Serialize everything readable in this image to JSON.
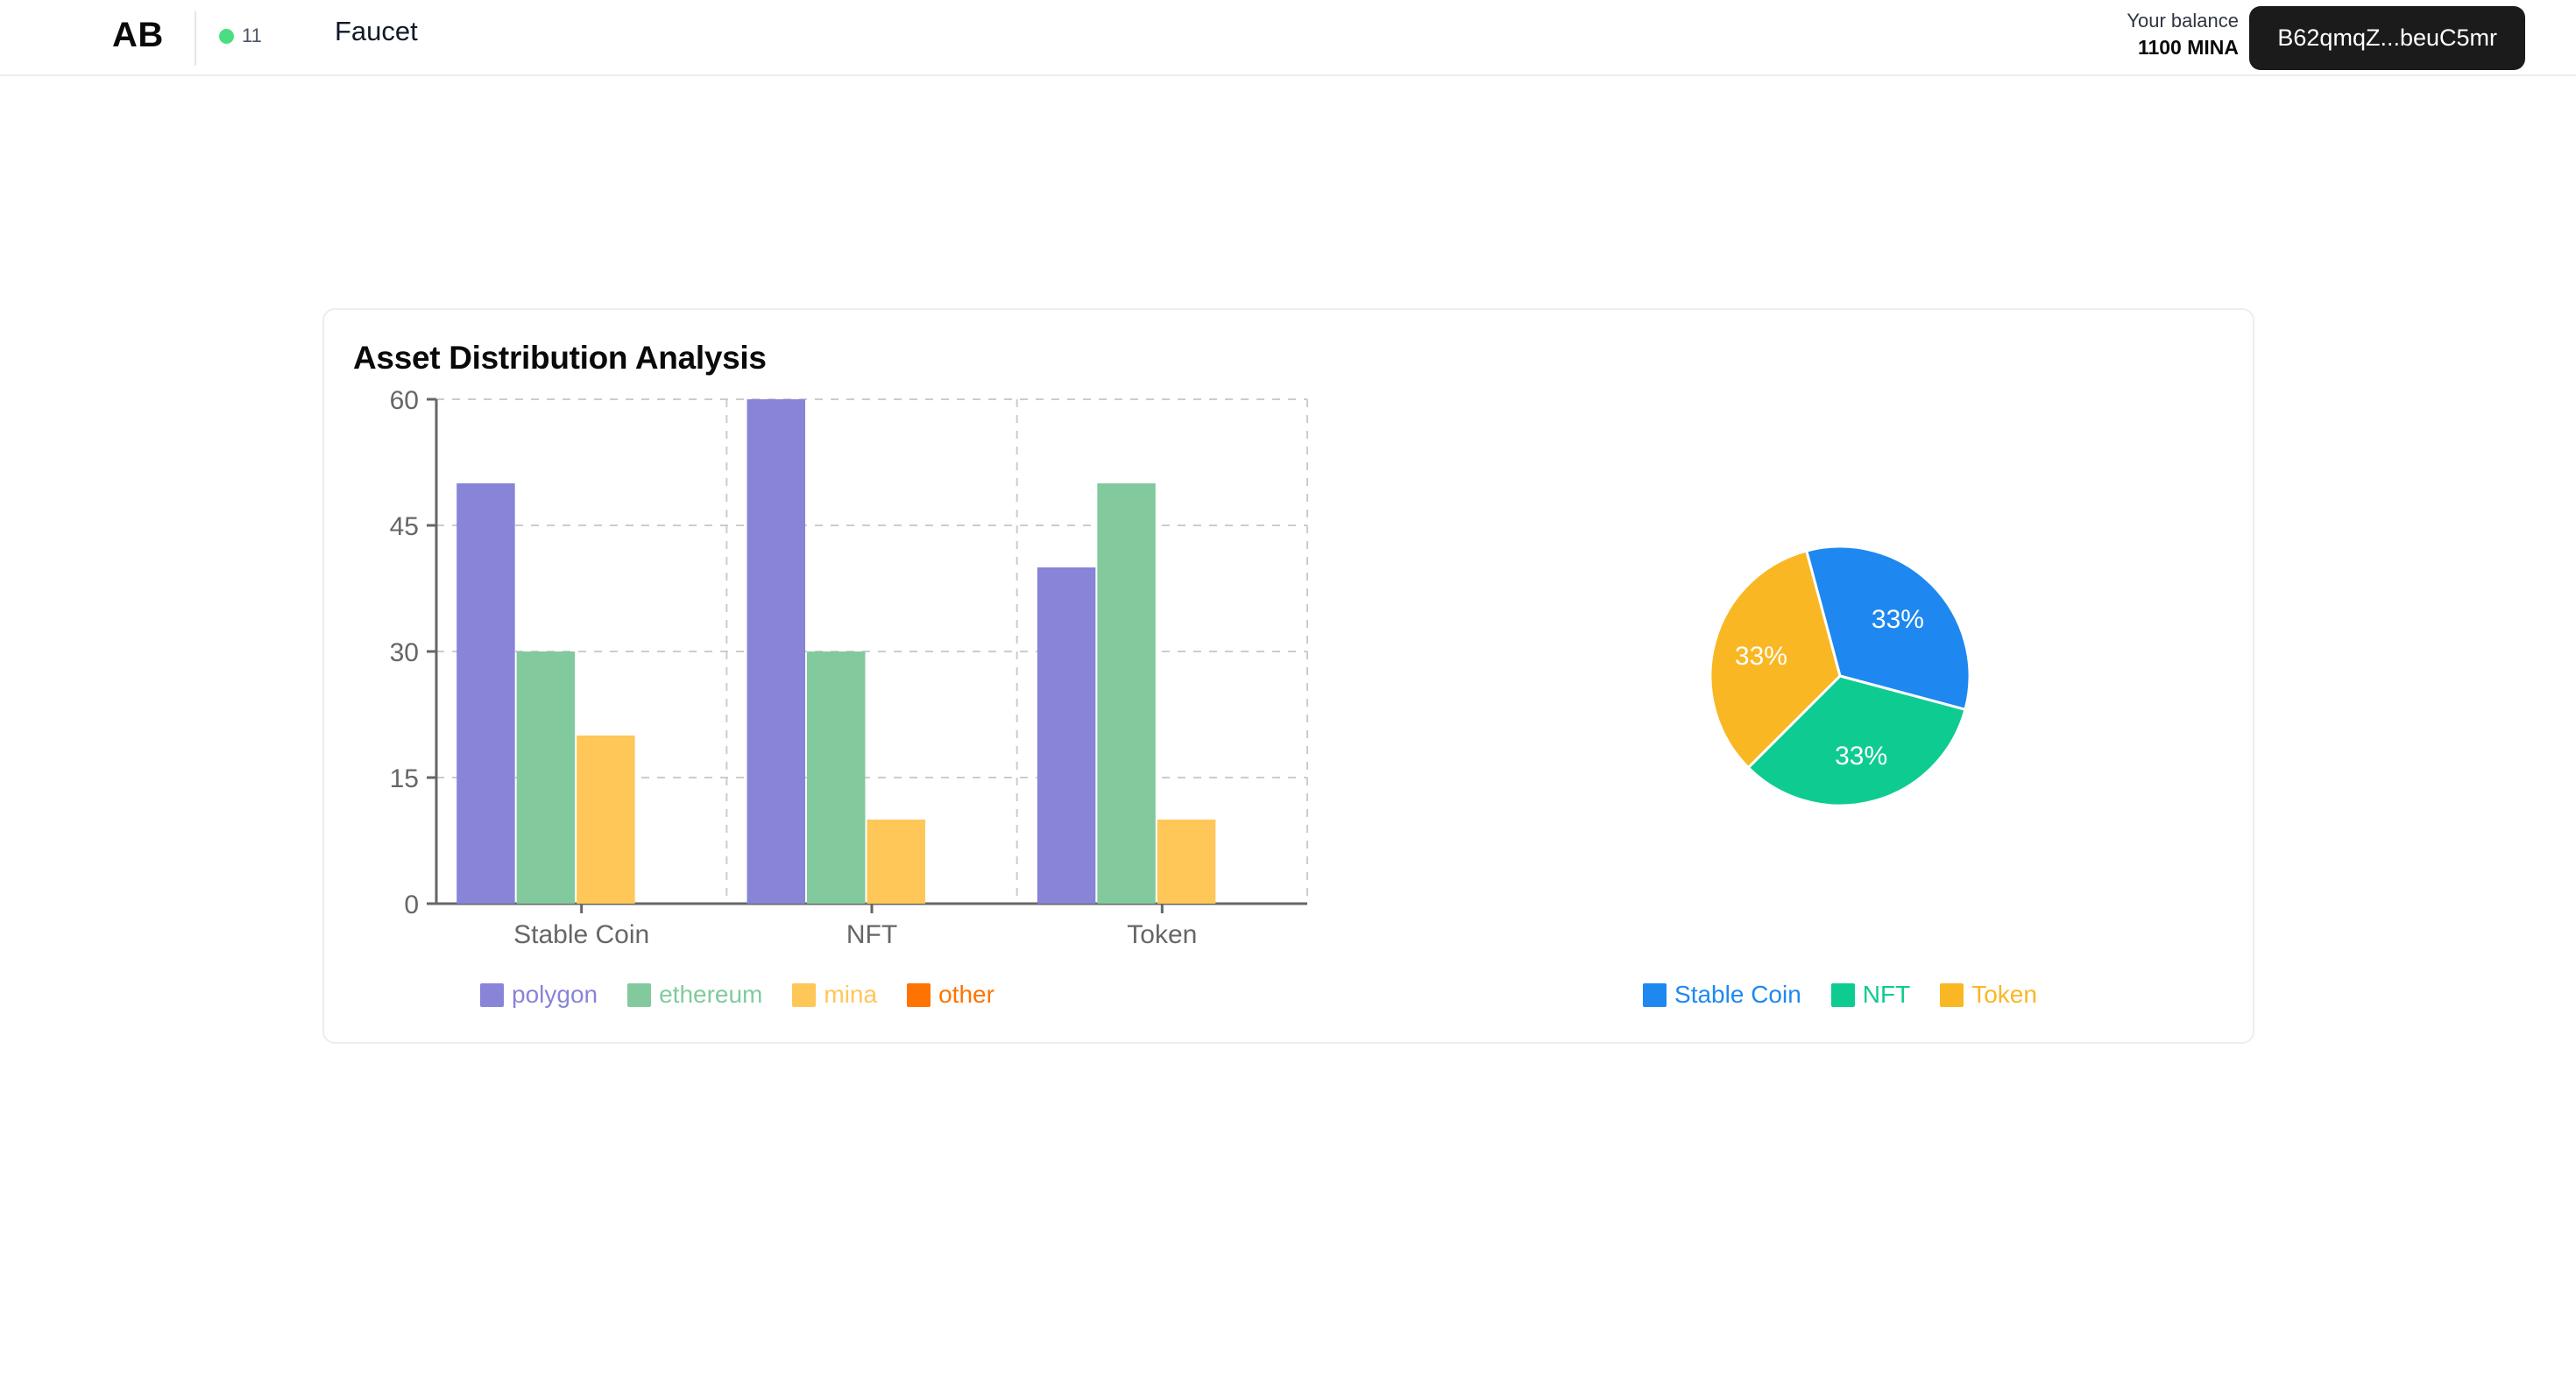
{
  "header": {
    "logo": "AB",
    "network_count": "11",
    "network_dot_color": "#4ade80",
    "page_title": "Faucet",
    "balance_label": "Your balance",
    "balance_value": "1100 MINA",
    "wallet_address": "B62qmqZ...beuC5mr"
  },
  "card": {
    "title": "Asset Distribution Analysis"
  },
  "chart_data": [
    {
      "type": "bar",
      "title": "Asset Distribution Analysis",
      "categories": [
        "Stable Coin",
        "NFT",
        "Token"
      ],
      "series": [
        {
          "name": "polygon",
          "color": "#8884d8",
          "values": [
            50,
            60,
            40
          ]
        },
        {
          "name": "ethereum",
          "color": "#82ca9d",
          "values": [
            30,
            30,
            50
          ]
        },
        {
          "name": "mina",
          "color": "#ffc658",
          "values": [
            20,
            10,
            10
          ]
        },
        {
          "name": "other",
          "color": "#ff7300",
          "values": [
            0,
            0,
            0
          ]
        }
      ],
      "ylabel": "",
      "xlabel": "",
      "yticks": [
        "0",
        "15",
        "30",
        "45",
        "60"
      ],
      "ylim": [
        0,
        60
      ],
      "grid": true,
      "legend_position": "bottom"
    },
    {
      "type": "pie",
      "labels": [
        "Stable Coin",
        "NFT",
        "Token"
      ],
      "values": [
        33,
        33,
        33
      ],
      "data_labels": [
        "33%",
        "33%",
        "33%"
      ],
      "colors": [
        "#1e88f0",
        "#0ecb92",
        "#f9b723"
      ],
      "legend_position": "bottom"
    }
  ]
}
